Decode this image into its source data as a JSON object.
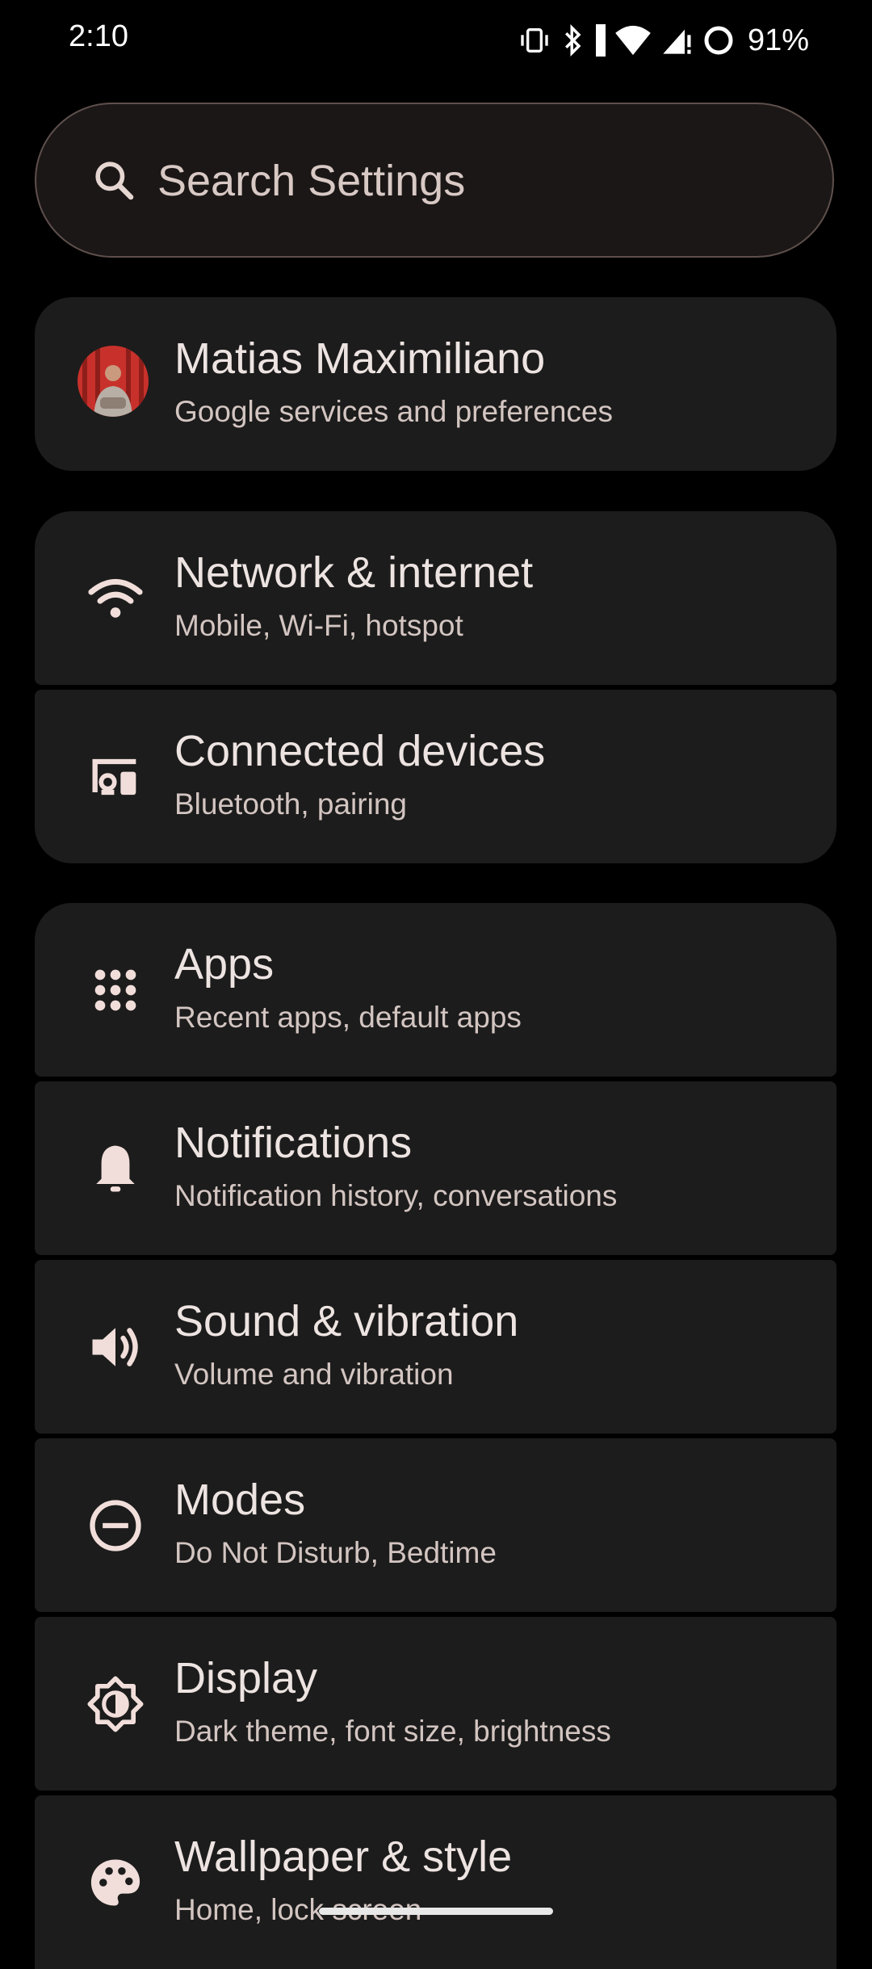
{
  "status_bar": {
    "time": "2:10",
    "battery": "91%"
  },
  "search": {
    "placeholder": "Search Settings"
  },
  "account": {
    "name": "Matias Maximiliano",
    "subtitle": "Google services and preferences"
  },
  "settings_items": [
    {
      "title": "Network & internet",
      "subtitle": "Mobile, Wi-Fi, hotspot",
      "icon": "wifi-icon"
    },
    {
      "title": "Connected devices",
      "subtitle": "Bluetooth, pairing",
      "icon": "connected-devices-icon"
    },
    {
      "title": "Apps",
      "subtitle": "Recent apps, default apps",
      "icon": "apps-grid-icon"
    },
    {
      "title": "Notifications",
      "subtitle": "Notification history, conversations",
      "icon": "bell-icon"
    },
    {
      "title": "Sound & vibration",
      "subtitle": "Volume and vibration",
      "icon": "speaker-icon"
    },
    {
      "title": "Modes",
      "subtitle": "Do Not Disturb, Bedtime",
      "icon": "do-not-disturb-icon"
    },
    {
      "title": "Display",
      "subtitle": "Dark theme, font size, brightness",
      "icon": "brightness-icon"
    },
    {
      "title": "Wallpaper & style",
      "subtitle": "Home, lock screen",
      "icon": "palette-icon"
    }
  ],
  "colors": {
    "background": "#000000",
    "card": "#1C1C1C",
    "icon": "#F1DEDA",
    "text_primary": "#EDE4E2",
    "text_secondary": "#D3C5C1"
  }
}
